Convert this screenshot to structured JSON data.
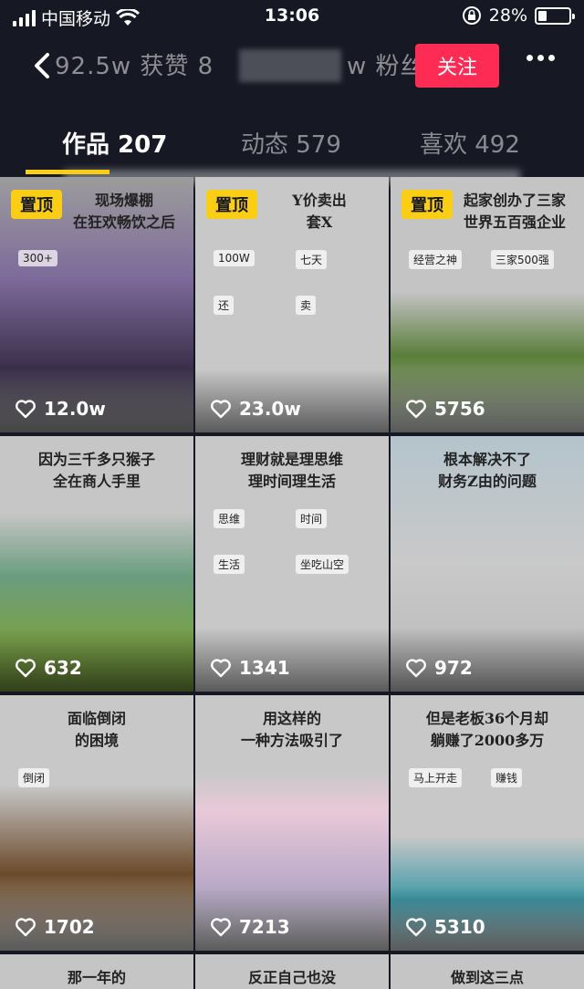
{
  "status_bar": {
    "carrier": "中国移动",
    "time": "13:06",
    "battery": "28%",
    "battery_level": 0.28
  },
  "header": {
    "stats_text": "92.5w 获赞  8",
    "stats_suffix": "w 粉丝",
    "follow_label": "关注"
  },
  "tabs": [
    {
      "label": "作品 207",
      "active": true
    },
    {
      "label": "动态 579",
      "active": false
    },
    {
      "label": "喜欢 492",
      "active": false
    }
  ],
  "pin_label": "置顶",
  "videos": [
    {
      "caption": "现场爆棚\n在狂欢畅饮之后",
      "likes": "12.0w",
      "pinned": true,
      "badge": "300+"
    },
    {
      "caption": "Y价卖出\n套X",
      "likes": "23.0w",
      "pinned": true,
      "labels": [
        "100W",
        "七天",
        "还",
        "卖"
      ]
    },
    {
      "caption": "起家创办了三家\n世界五百强企业",
      "likes": "5756",
      "pinned": true,
      "labels": [
        "经营之神",
        "三家500强"
      ]
    },
    {
      "caption": "因为三千多只猴子\n全在商人手里",
      "likes": "632",
      "pinned": false
    },
    {
      "caption": "理财就是理思维\n理时间理生活",
      "likes": "1341",
      "pinned": false,
      "labels": [
        "思维",
        "时间",
        "生活",
        "坐吃山空"
      ]
    },
    {
      "caption": "根本解决不了\n财务Z由的问题",
      "likes": "972",
      "pinned": false
    },
    {
      "caption": "面临倒闭\n的困境",
      "likes": "1702",
      "pinned": false,
      "labels": [
        "倒闭"
      ]
    },
    {
      "caption": "用这样的\n一种方法吸引了",
      "likes": "7213",
      "pinned": false
    },
    {
      "caption": "但是老板36个月却\n躺赚了2000多万",
      "likes": "5310",
      "pinned": false,
      "labels": [
        "马上开走",
        "赚钱"
      ]
    },
    {
      "caption": "那一年的",
      "likes": "",
      "pinned": false
    },
    {
      "caption": "反正自己也没",
      "likes": "",
      "pinned": false
    },
    {
      "caption": "做到这三点",
      "likes": "",
      "pinned": false
    }
  ],
  "colors": {
    "accent": "#fe2c55",
    "indicator": "#face15",
    "background": "#161823"
  }
}
